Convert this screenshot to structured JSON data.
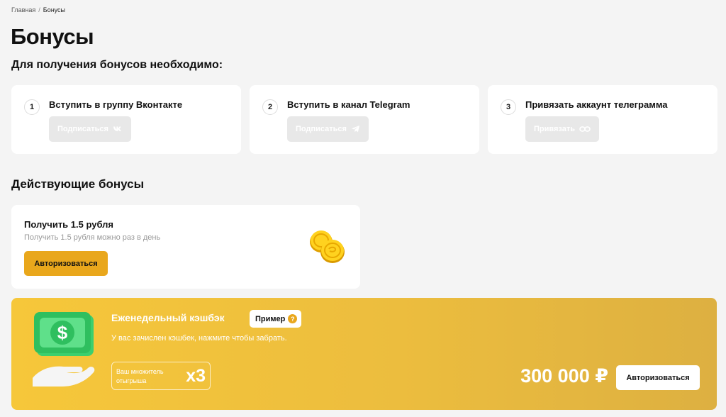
{
  "breadcrumb": {
    "home": "Главная",
    "separator": "/",
    "current": "Бонусы"
  },
  "page": {
    "title": "Бонусы",
    "subtitle": "Для получения бонусов необходимо:"
  },
  "steps": [
    {
      "num": "1",
      "title": "Вступить в группу Вконтакте",
      "button": "Подписаться",
      "icon": "vk-icon"
    },
    {
      "num": "2",
      "title": "Вступить в канал Telegram",
      "button": "Подписаться",
      "icon": "telegram-icon"
    },
    {
      "num": "3",
      "title": "Привязать аккаунт телеграмма",
      "button": "Привязать",
      "icon": "link-icon"
    }
  ],
  "active": {
    "section_title": "Действующие бонусы",
    "bonus": {
      "title": "Получить 1.5 рубля",
      "description": "Получить 1.5 рубля можно раз в день",
      "button": "Авторизоваться",
      "icon": "coins-icon"
    }
  },
  "cashback": {
    "title": "Еженедельный кэшбэк",
    "example_label": "Пример",
    "example_icon": "?",
    "description": "У вас зачислен кэшбек, нажмите чтобы забрать.",
    "multiplier_label": "Ваш множитель отыгрыша",
    "multiplier_value": "x3",
    "amount": "300 000 ₽",
    "button": "Авторизоваться",
    "icon": "cash-hand-icon"
  },
  "colors": {
    "accent": "#e9a71c",
    "cashback_bg": "#f2c33c",
    "card_bg": "#ffffff",
    "page_bg": "#f4f4f4",
    "disabled_button": "#e8e8e8"
  }
}
